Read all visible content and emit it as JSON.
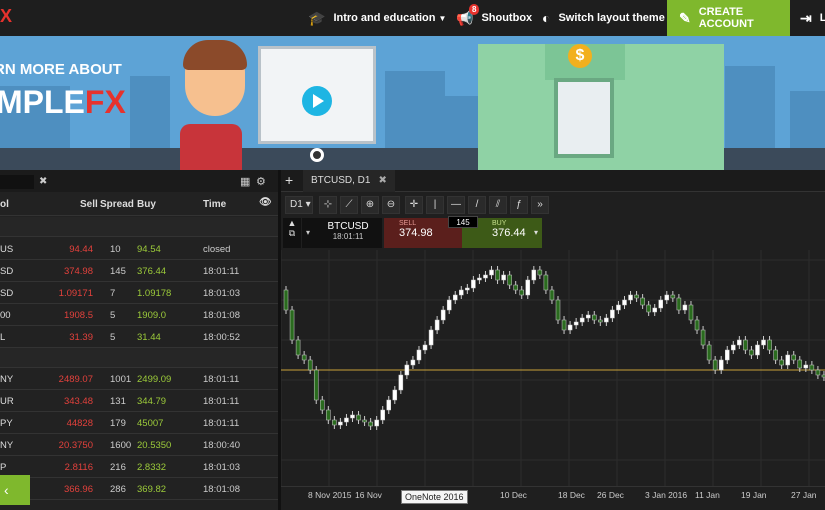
{
  "nav": {
    "logo": "X",
    "intro": "Intro and education",
    "shoutbox": "Shoutbox",
    "shoutbox_badge": "8",
    "theme": "Switch layout theme",
    "create": "CREATE ACCOUNT",
    "login": "L"
  },
  "banner": {
    "line1": "RN MORE ABOUT",
    "brand_a": "MPLE",
    "brand_b": "FX"
  },
  "watchlist": {
    "headers": {
      "symbol": "ol",
      "sell": "Sell",
      "spread": "Spread",
      "buy": "Buy",
      "time": "Time"
    },
    "group1": [
      {
        "symbol": "US",
        "sell": "94.44",
        "spread": "10",
        "buy": "94.54",
        "time": "closed"
      },
      {
        "symbol": "SD",
        "sell": "374.98",
        "spread": "145",
        "buy": "376.44",
        "time": "18:01:11"
      },
      {
        "symbol": "SD",
        "sell": "1.09171",
        "spread": "7",
        "buy": "1.09178",
        "time": "18:01:03"
      },
      {
        "symbol": "00",
        "sell": "1908.5",
        "spread": "5",
        "buy": "1909.0",
        "time": "18:01:08"
      },
      {
        "symbol": "L",
        "sell": "31.39",
        "spread": "5",
        "buy": "31.44",
        "time": "18:00:52"
      }
    ],
    "group2": [
      {
        "symbol": "NY",
        "sell": "2489.07",
        "spread": "1001",
        "buy": "2499.09",
        "time": "18:01:11"
      },
      {
        "symbol": "UR",
        "sell": "343.48",
        "spread": "131",
        "buy": "344.79",
        "time": "18:01:11"
      },
      {
        "symbol": "PY",
        "sell": "44828",
        "spread": "179",
        "buy": "45007",
        "time": "18:01:11"
      },
      {
        "symbol": "NY",
        "sell": "20.3750",
        "spread": "1600",
        "buy": "20.5350",
        "time": "18:00:40"
      },
      {
        "symbol": "P",
        "sell": "2.8116",
        "spread": "216",
        "buy": "2.8332",
        "time": "18:01:03"
      },
      {
        "symbol": "",
        "sell": "366.96",
        "spread": "286",
        "buy": "369.82",
        "time": "18:01:08"
      }
    ]
  },
  "chart_panel": {
    "tab": "BTCUSD, D1",
    "timeframe": "D1",
    "ticket": {
      "symbol": "BTCUSD",
      "time": "18:01:11",
      "sell_label": "SELL",
      "sell": "374.98",
      "buy_label": "BUY",
      "buy": "376.44",
      "spread": "145"
    },
    "xlabels": [
      "8 Nov 2015",
      "16 Nov",
      "ec",
      "10 Dec",
      "18 Dec",
      "26 Dec",
      "3 Jan 2016",
      "11 Jan",
      "19 Jan",
      "27 Jan"
    ],
    "tooltip": "OneNote 2016"
  },
  "colors": {
    "accent": "#7fb82d",
    "sell": "#e2413c",
    "buy": "#9ccb3a",
    "brand": "#e6322d"
  }
}
